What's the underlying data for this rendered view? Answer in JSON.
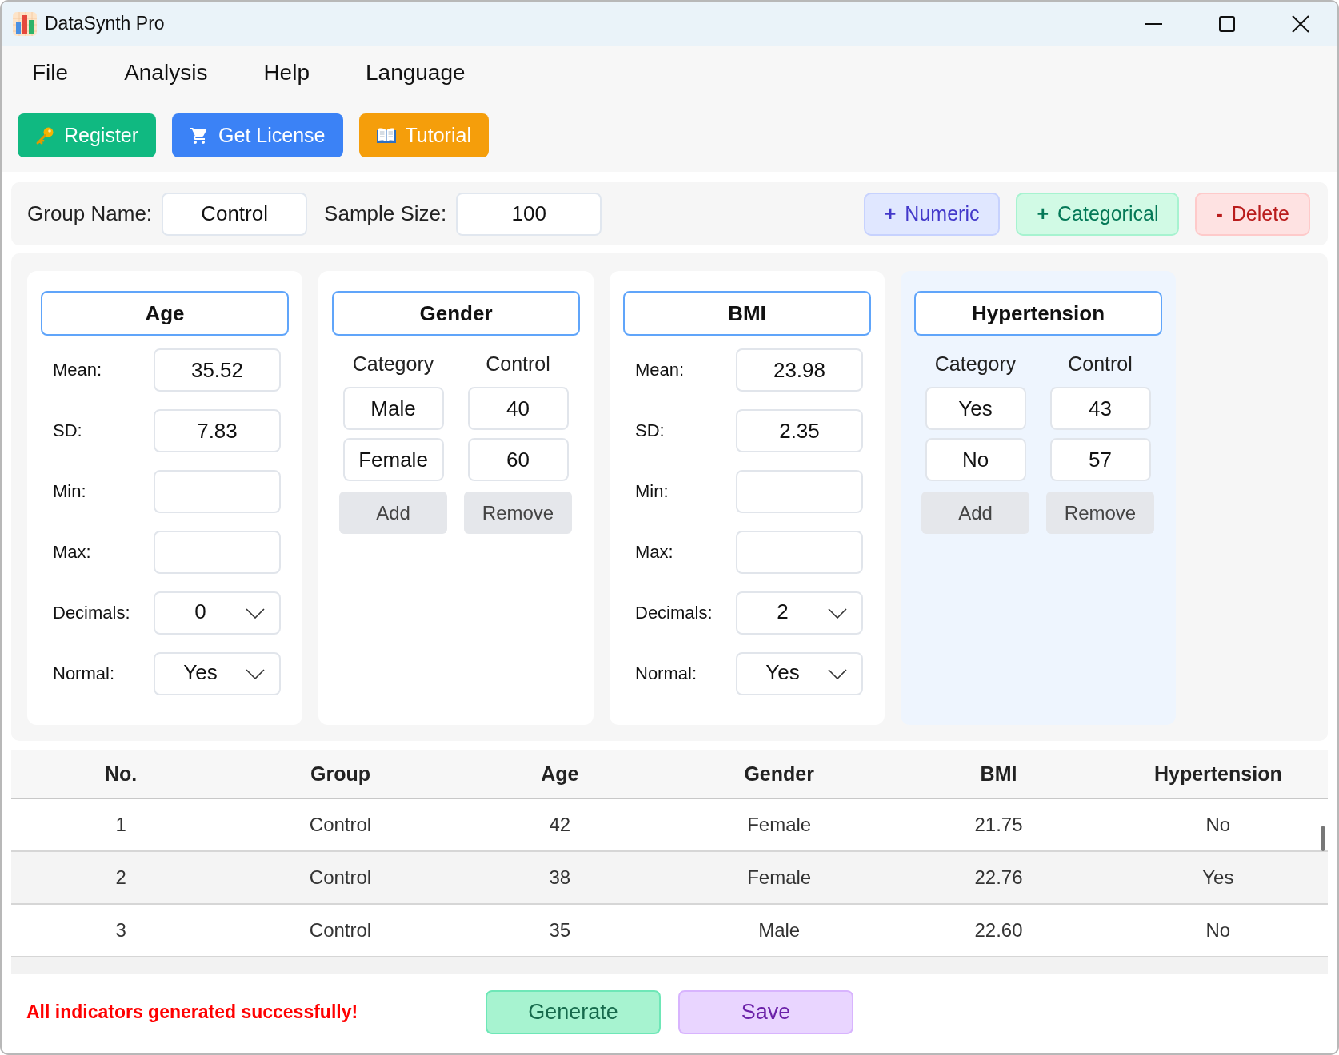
{
  "window": {
    "title": "DataSynth Pro"
  },
  "menu": [
    "File",
    "Analysis",
    "Help",
    "Language"
  ],
  "toolbar": [
    {
      "label": "Register",
      "kind": "register"
    },
    {
      "label": "Get License",
      "kind": "license"
    },
    {
      "label": "Tutorial",
      "kind": "tutorial"
    }
  ],
  "group": {
    "name_label": "Group Name:",
    "name": "Control",
    "size_label": "Sample Size:",
    "size": "100",
    "actions": [
      {
        "label": "**+** Numeric",
        "kind": "numeric"
      },
      {
        "label": "**+** Categorical",
        "kind": "categorical"
      },
      {
        "label": "**-** Delete",
        "kind": "delete"
      }
    ]
  },
  "variables": [
    {
      "kind": "numeric",
      "name": "Age",
      "selected": false,
      "fields": [
        {
          "label": "Mean:",
          "kind": "input",
          "value": "35.52"
        },
        {
          "label": "SD:",
          "kind": "input",
          "value": "7.83"
        },
        {
          "label": "Min:",
          "kind": "input"
        },
        {
          "label": "Max:",
          "kind": "input"
        },
        {
          "label": "Decimals:",
          "kind": "dropdown",
          "value": "0"
        },
        {
          "label": "Normal:",
          "kind": "dropdown",
          "value": "Yes"
        }
      ]
    },
    {
      "kind": "categorical",
      "name": "Gender",
      "selected": false,
      "columns": [
        "Category",
        "Control"
      ],
      "categories": [
        {
          "name": "Male",
          "count": "40"
        },
        {
          "name": "Female",
          "count": "60"
        }
      ],
      "buttons": [
        "Add",
        "Remove"
      ]
    },
    {
      "kind": "numeric",
      "name": "BMI",
      "selected": false,
      "fields": [
        {
          "label": "Mean:",
          "kind": "input",
          "value": "23.98"
        },
        {
          "label": "SD:",
          "kind": "input",
          "value": "2.35"
        },
        {
          "label": "Min:",
          "kind": "input"
        },
        {
          "label": "Max:",
          "kind": "input"
        },
        {
          "label": "Decimals:",
          "kind": "dropdown",
          "value": "2"
        },
        {
          "label": "Normal:",
          "kind": "dropdown",
          "value": "Yes"
        }
      ]
    },
    {
      "kind": "categorical",
      "name": "Hypertension",
      "selected": true,
      "columns": [
        "Category",
        "Control"
      ],
      "categories": [
        {
          "name": "Yes",
          "count": "43"
        },
        {
          "name": "No",
          "count": "57"
        }
      ],
      "buttons": [
        "Add",
        "Remove"
      ]
    }
  ],
  "table": {
    "columns": [
      "No.",
      "Group",
      "Age",
      "Gender",
      "BMI",
      "Hypertension"
    ],
    "rows": [
      [
        "1",
        "Control",
        "42",
        "Female",
        "21.75",
        "No"
      ],
      [
        "2",
        "Control",
        "38",
        "Female",
        "22.76",
        "Yes"
      ],
      [
        "3",
        "Control",
        "35",
        "Male",
        "22.60",
        "No"
      ]
    ]
  },
  "footer": {
    "status": "All indicators generated successfully!",
    "buttons": [
      {
        "label": "Generate",
        "kind": "generate"
      },
      {
        "label": "Save",
        "kind": "save"
      }
    ]
  }
}
